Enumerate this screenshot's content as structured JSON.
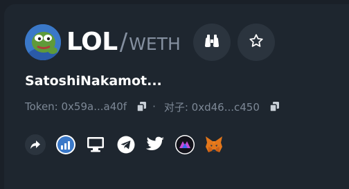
{
  "token": {
    "symbol": "LOL",
    "slash": "/",
    "quote": "WETH",
    "name": "SatoshiNakamot...",
    "token_address": "Token: 0x59a...a40f",
    "separator": "·",
    "pair_address": "对子: 0xd46...c450"
  },
  "header_buttons": [
    "binoculars-icon",
    "star-icon"
  ],
  "links": [
    "share-icon",
    "chart-site-icon",
    "website-icon",
    "telegram-icon",
    "twitter-icon",
    "dex-icon",
    "metamask-icon"
  ],
  "colors": {
    "background": "#1a2028",
    "card": "#1e262f",
    "button": "#2b343e",
    "text_primary": "#ffffff",
    "text_secondary": "#7d8896",
    "accent_blue": "#3a78c8"
  }
}
